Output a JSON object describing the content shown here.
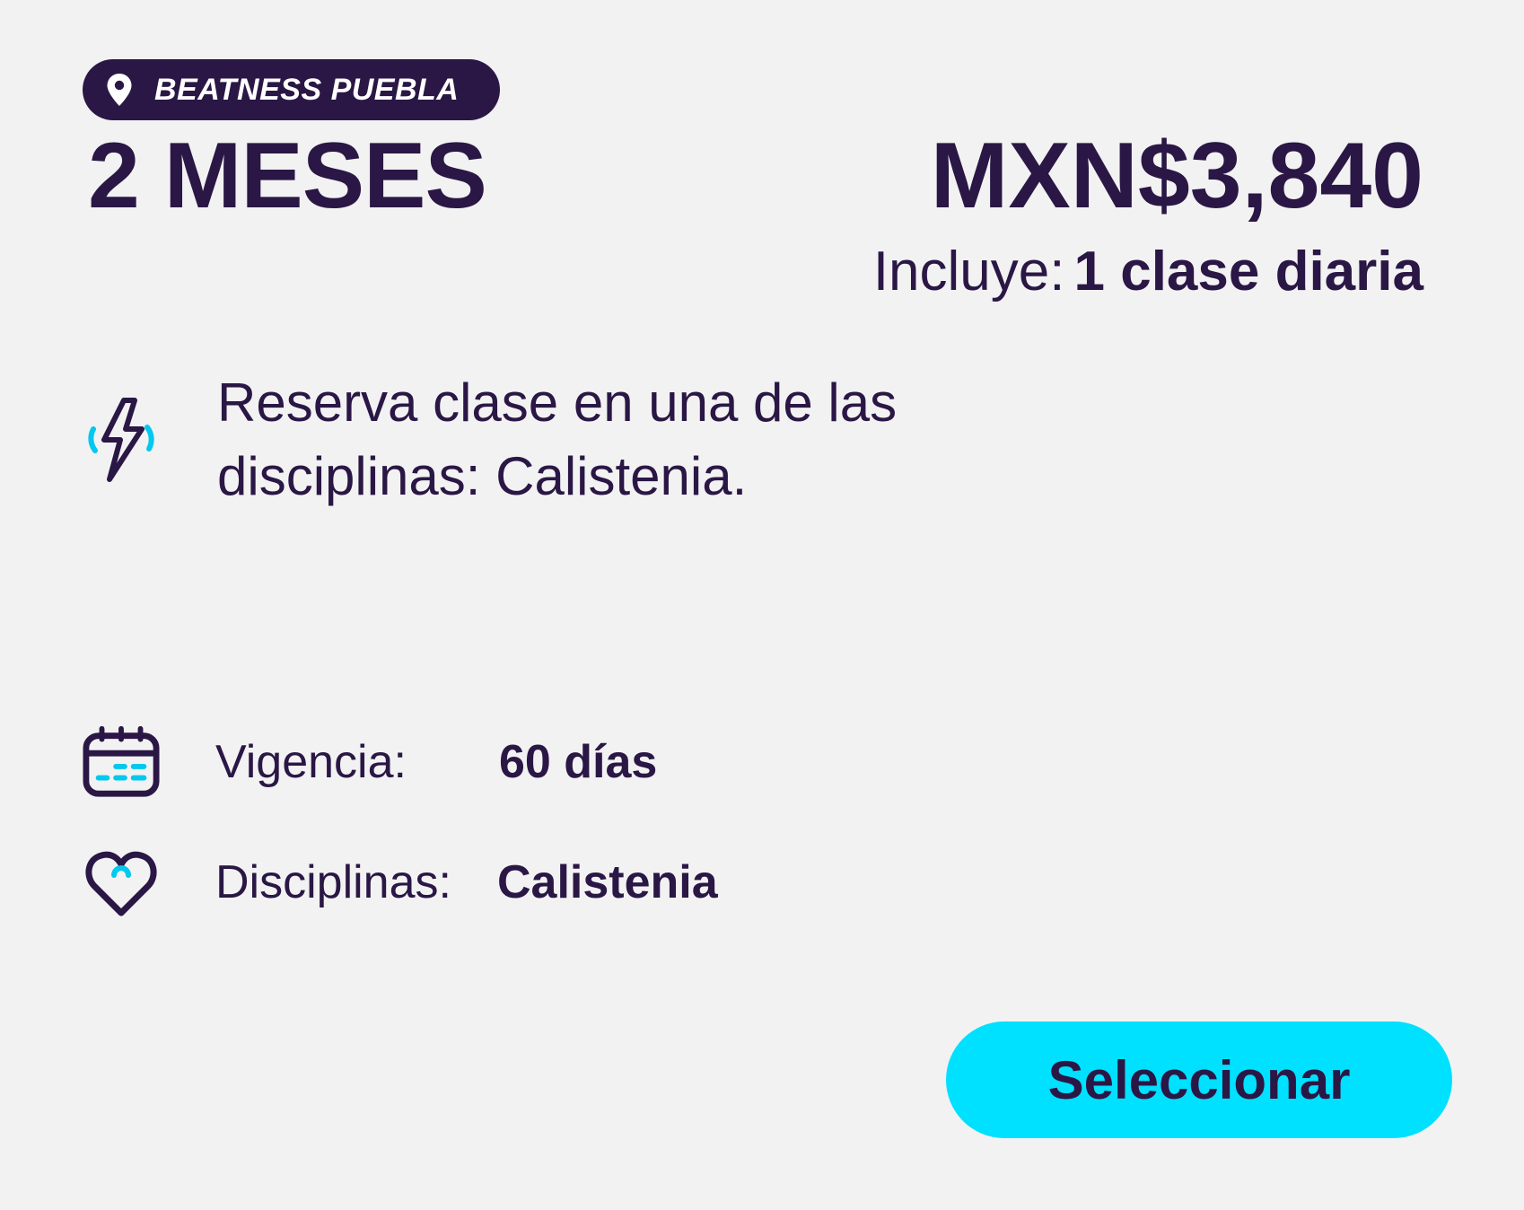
{
  "location": {
    "icon": "map-pin-icon",
    "name": "BEATNESS PUEBLA"
  },
  "plan": {
    "title": "2 MESES",
    "price": "MXN$3,840",
    "includes_label": "Incluye:",
    "includes_value": "1 clase diaria"
  },
  "description": {
    "icon": "lightning-bolt-icon",
    "text": "Reserva clase en una de las disciplinas: Calistenia."
  },
  "details": {
    "validity": {
      "icon": "calendar-icon",
      "label": "Vigencia:",
      "value": "60 días"
    },
    "disciplines": {
      "icon": "heart-icon",
      "label": "Disciplinas:",
      "value": "Calistenia"
    }
  },
  "actions": {
    "select_label": "Seleccionar"
  },
  "colors": {
    "primary": "#2a1745",
    "accent": "#00e0ff",
    "background": "#f2f2f2"
  }
}
